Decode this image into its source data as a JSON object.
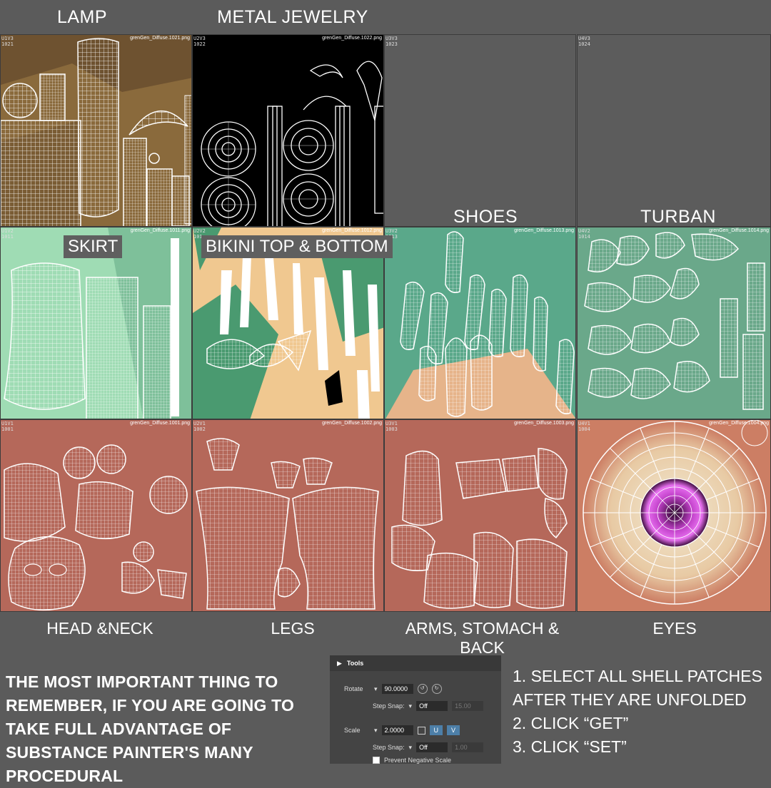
{
  "header_labels": [
    "LAMP",
    "METAL JEWELRY"
  ],
  "overlay_labels": {
    "shoes": "SHOES",
    "turban": "TURBAN",
    "skirt": "SKIRT",
    "bikini": "BIKINI TOP & BOTTOM"
  },
  "tiles": [
    {
      "id": "U1V3\n1021",
      "file": "grenGen_Diffuse.1021.png"
    },
    {
      "id": "U2V3\n1022",
      "file": "grenGen_Diffuse.1022.png"
    },
    {
      "id": "U3V3\n1023",
      "file": ""
    },
    {
      "id": "U4V3\n1024",
      "file": ""
    },
    {
      "id": "U1V2\n1011",
      "file": "grenGen_Diffuse.1011.png"
    },
    {
      "id": "U2V2\n101",
      "file": "grenGen_Diffuse.1012.png"
    },
    {
      "id": "U3V2\n1013",
      "file": "grenGen_Diffuse.1013.png"
    },
    {
      "id": "U4V2\n1014",
      "file": "grenGen_Diffuse.1014.png"
    },
    {
      "id": "U1V1\n1001",
      "file": "grenGen_Diffuse.1001.png"
    },
    {
      "id": "U2V1\n1002",
      "file": "grenGen_Diffuse.1002.png"
    },
    {
      "id": "U3V1\n1003",
      "file": "grenGen_Diffuse.1003.png"
    },
    {
      "id": "U4V1\n1004",
      "file": "grenGen_Diffuse.1004.png"
    }
  ],
  "bottom_labels": [
    "HEAD &NECK",
    "LEGS",
    "ARMS, STOMACH & BACK",
    "EYES"
  ],
  "notes": "THE MOST IMPORTANT THING TO REMEMBER, IF YOU ARE GOING TO TAKE FULL ADVANTAGE OF SUBSTANCE PAINTER'S MANY PROCEDURAL",
  "steps": [
    "1. SELECT ALL SHELL PATCHES",
    "AFTER THEY ARE UNFOLDED",
    "2. CLICK “GET”",
    "3. CLICK “SET”"
  ],
  "tools": {
    "title": "Tools",
    "rotate_label": "Rotate",
    "rotate_value": "90.0000",
    "step_snap_label": "Step Snap:",
    "step_snap_value": "Off",
    "rotate_snap_value": "15.00",
    "scale_label": "Scale",
    "scale_value": "2.0000",
    "u_label": "U",
    "v_label": "V",
    "scale_snap_value": "1.00",
    "prevent_label": "Prevent Negative Scale"
  },
  "colors": {
    "lamp": "#8a6a3c",
    "jewelry": "#000000",
    "skirt": "#8fd4a8",
    "bikini": "#f0c890",
    "shoes": "#5aa88a",
    "turban": "#6aa88a",
    "skin": "#b5685a",
    "eye": "#cc7e64",
    "iris": "#c040c8",
    "empty": "#5c5c5c"
  }
}
